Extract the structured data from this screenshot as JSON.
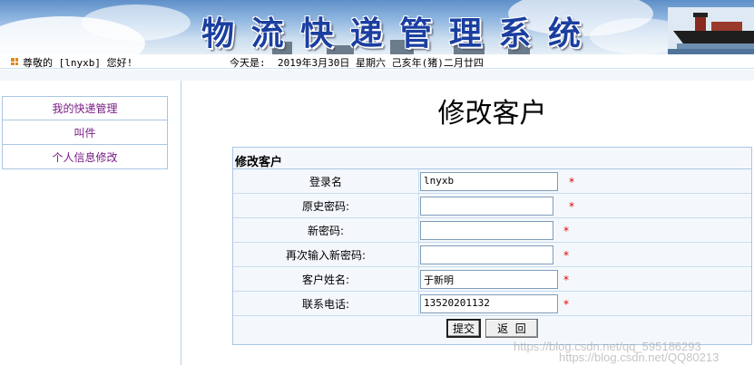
{
  "banner": {
    "chars": [
      "物",
      "流",
      "快",
      "递",
      "管",
      "理",
      "系",
      "统"
    ]
  },
  "infobar": {
    "greeting": "尊敬的 [lnyxb] 您好!",
    "date_label": "今天是:",
    "date_value": "2019年3月30日 星期六 己亥年(猪)二月廿四"
  },
  "sidebar": {
    "items": [
      {
        "label": "我的快递管理"
      },
      {
        "label": "叫件"
      },
      {
        "label": "个人信息修改"
      }
    ]
  },
  "main": {
    "page_title": "修改客户",
    "form_title": "修改客户",
    "fields": [
      {
        "label": "登录名",
        "value": "lnyxb",
        "required_mark": "*"
      },
      {
        "label": "原史密码:",
        "value": "",
        "required_mark": "*"
      },
      {
        "label": "新密码:",
        "value": "",
        "required_mark": "*"
      },
      {
        "label": "再次输入新密码:",
        "value": "",
        "required_mark": "*"
      },
      {
        "label": "客户姓名:",
        "value": "于新明",
        "required_mark": "*"
      },
      {
        "label": "联系电话:",
        "value": "13520201132",
        "required_mark": "*"
      }
    ],
    "submit_label": "提交",
    "back_label": "返  回"
  },
  "watermark": {
    "line1": "https://blog.csdn.net/qq_595186293",
    "line2": "https://blog.csdn.net/QQ80213"
  },
  "colors": {
    "title_blue": "#1b3fa0",
    "sidebar_link": "#7a1c86",
    "required_red": "#e00000",
    "border_blue": "#a9c6e4"
  }
}
